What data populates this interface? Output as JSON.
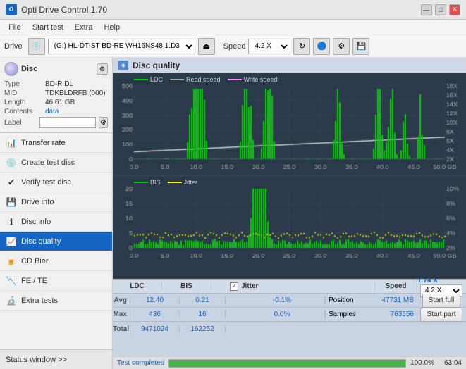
{
  "app": {
    "title": "Opti Drive Control 1.70",
    "window_controls": [
      "—",
      "□",
      "✕"
    ]
  },
  "menubar": {
    "items": [
      "File",
      "Start test",
      "Extra",
      "Help"
    ]
  },
  "toolbar": {
    "drive_label": "Drive",
    "drive_value": "(G:)  HL-DT-ST BD-RE  WH16NS48 1.D3",
    "speed_label": "Speed",
    "speed_value": "4.2 X"
  },
  "disc_info": {
    "title": "Disc",
    "type_label": "Type",
    "type_value": "BD-R DL",
    "mid_label": "MID",
    "mid_value": "TDKBLDRFB (000)",
    "length_label": "Length",
    "length_value": "46.61 GB",
    "contents_label": "Contents",
    "contents_value": "data",
    "label_label": "Label",
    "label_value": ""
  },
  "sidebar": {
    "items": [
      {
        "id": "transfer-rate",
        "label": "Transfer rate",
        "icon": "📊"
      },
      {
        "id": "create-test-disc",
        "label": "Create test disc",
        "icon": "💿"
      },
      {
        "id": "verify-test-disc",
        "label": "Verify test disc",
        "icon": "✔"
      },
      {
        "id": "drive-info",
        "label": "Drive info",
        "icon": "💾"
      },
      {
        "id": "disc-info",
        "label": "Disc info",
        "icon": "ℹ"
      },
      {
        "id": "disc-quality",
        "label": "Disc quality",
        "icon": "📈",
        "active": true
      },
      {
        "id": "cd-bier",
        "label": "CD Bier",
        "icon": "🍺"
      },
      {
        "id": "fe-te",
        "label": "FE / TE",
        "icon": "📉"
      },
      {
        "id": "extra-tests",
        "label": "Extra tests",
        "icon": "🔬"
      }
    ],
    "status_window": "Status window >>"
  },
  "disc_quality": {
    "title": "Disc quality",
    "chart1": {
      "legend": [
        {
          "label": "LDC",
          "color": "#00cc00"
        },
        {
          "label": "Read speed",
          "color": "#aaaaaa"
        },
        {
          "label": "Write speed",
          "color": "#ff88ff"
        }
      ],
      "y_max": 500,
      "y_labels": [
        "500",
        "400",
        "300",
        "200",
        "100",
        "0"
      ],
      "y_right_labels": [
        "18X",
        "16X",
        "14X",
        "12X",
        "10X",
        "8X",
        "6X",
        "4X",
        "2X"
      ],
      "x_labels": [
        "0.0",
        "5.0",
        "10.0",
        "15.0",
        "20.0",
        "25.0",
        "30.0",
        "35.0",
        "40.0",
        "45.0",
        "50.0 GB"
      ]
    },
    "chart2": {
      "legend": [
        {
          "label": "BIS",
          "color": "#00cc00"
        },
        {
          "label": "Jitter",
          "color": "#ffff00"
        }
      ],
      "y_max": 20,
      "y_labels": [
        "20",
        "15",
        "10",
        "5",
        "0"
      ],
      "y_right_labels": [
        "10%",
        "8%",
        "6%",
        "4%",
        "2%"
      ],
      "x_labels": [
        "0.0",
        "5.0",
        "10.0",
        "15.0",
        "20.0",
        "25.0",
        "30.0",
        "35.0",
        "40.0",
        "45.0",
        "50.0 GB"
      ]
    },
    "stats": {
      "headers": [
        "LDC",
        "BIS",
        "",
        "Jitter",
        "Speed",
        ""
      ],
      "avg_label": "Avg",
      "avg_ldc": "12.40",
      "avg_bis": "0.21",
      "avg_jitter": "-0.1%",
      "max_label": "Max",
      "max_ldc": "436",
      "max_bis": "16",
      "max_jitter": "0.0%",
      "total_label": "Total",
      "total_ldc": "9471024",
      "total_bis": "162252",
      "jitter_checked": true,
      "speed_value": "1.74 X",
      "speed_select": "4.2 X",
      "position_label": "Position",
      "position_value": "47731 MB",
      "samples_label": "Samples",
      "samples_value": "763556"
    },
    "buttons": {
      "start_full": "Start full",
      "start_part": "Start part"
    }
  },
  "statusbar": {
    "status_text": "Test completed",
    "progress_pct": 100,
    "progress_display": "100.0%",
    "right_value": "63:04"
  }
}
